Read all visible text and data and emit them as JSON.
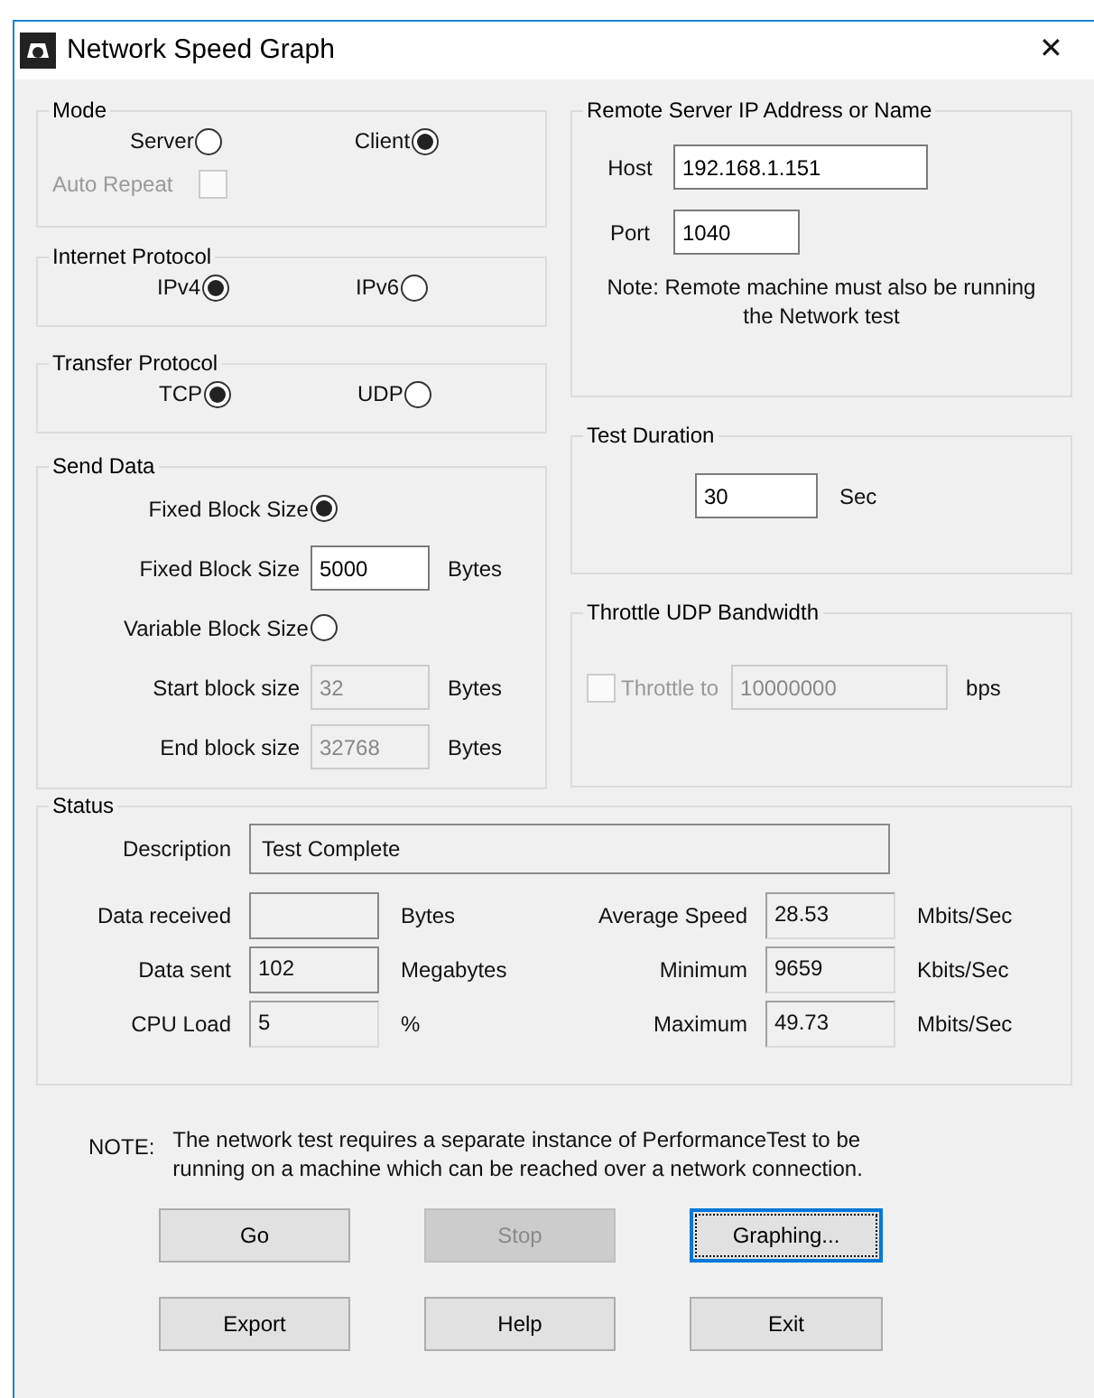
{
  "window": {
    "title": "Network Speed Graph",
    "close": "✕"
  },
  "mode": {
    "title": "Mode",
    "options": [
      {
        "label": "Server",
        "selected": false
      },
      {
        "label": "Client",
        "selected": true
      }
    ],
    "auto_repeat": {
      "label": "Auto Repeat",
      "checked": false,
      "disabled": true
    }
  },
  "internet_protocol": {
    "title": "Internet Protocol",
    "options": [
      {
        "label": "IPv4",
        "selected": true
      },
      {
        "label": "IPv6",
        "selected": false
      }
    ]
  },
  "transfer_protocol": {
    "title": "Transfer Protocol",
    "options": [
      {
        "label": "TCP",
        "selected": true
      },
      {
        "label": "UDP",
        "selected": false
      }
    ]
  },
  "send_data": {
    "title": "Send Data",
    "rows": [
      {
        "kind": "radio",
        "label": "Fixed Block Size",
        "selected": true
      },
      {
        "kind": "field",
        "label": "Fixed Block Size",
        "value": "5000",
        "unit": "Bytes",
        "disabled": false
      },
      {
        "kind": "radio",
        "label": "Variable Block Size",
        "selected": false
      },
      {
        "kind": "field",
        "label": "Start block size",
        "value": "32",
        "unit": "Bytes",
        "disabled": true
      },
      {
        "kind": "field",
        "label": "End block size",
        "value": "32768",
        "unit": "Bytes",
        "disabled": true
      }
    ]
  },
  "remote": {
    "title": "Remote Server IP Address or Name",
    "host": {
      "label": "Host",
      "value": "192.168.1.151"
    },
    "port": {
      "label": "Port",
      "value": "1040"
    },
    "note": "Note: Remote machine must also be running the Network test"
  },
  "duration": {
    "title": "Test Duration",
    "value": "30",
    "unit": "Sec"
  },
  "throttle": {
    "title": "Throttle UDP Bandwidth",
    "label": "Throttle to",
    "checked": false,
    "disabled": true,
    "value": "10000000",
    "unit": "bps"
  },
  "status": {
    "title": "Status",
    "description": {
      "label": "Description",
      "value": "Test Complete"
    },
    "left": [
      {
        "label": "Data received",
        "unit": "Bytes",
        "kind": "boxed"
      },
      {
        "label": "Data sent",
        "value": "102",
        "unit": "Megabytes",
        "kind": "boxed"
      },
      {
        "label": "CPU Load",
        "value": "5",
        "unit": "%",
        "kind": "flat"
      }
    ],
    "right": [
      {
        "label": "Average Speed",
        "value": "28.53",
        "unit": "Mbits/Sec",
        "kind": "flat"
      },
      {
        "label": "Minimum",
        "value": "9659",
        "unit": "Kbits/Sec",
        "kind": "flat"
      },
      {
        "label": "Maximum",
        "value": "49.73",
        "unit": "Mbits/Sec",
        "kind": "flat"
      }
    ]
  },
  "note": {
    "label": "NOTE:",
    "text": "The network test requires a separate instance of PerformanceTest to be running on a machine which can be reached over a network connection."
  },
  "buttons": [
    {
      "label": "Go",
      "disabled": false,
      "focused": false
    },
    {
      "label": "Stop",
      "disabled": true,
      "focused": false
    },
    {
      "label": "Graphing...",
      "disabled": false,
      "focused": true
    },
    {
      "label": "Export",
      "disabled": false,
      "focused": false
    },
    {
      "label": "Help",
      "disabled": false,
      "focused": false
    },
    {
      "label": "Exit",
      "disabled": false,
      "focused": false
    }
  ]
}
